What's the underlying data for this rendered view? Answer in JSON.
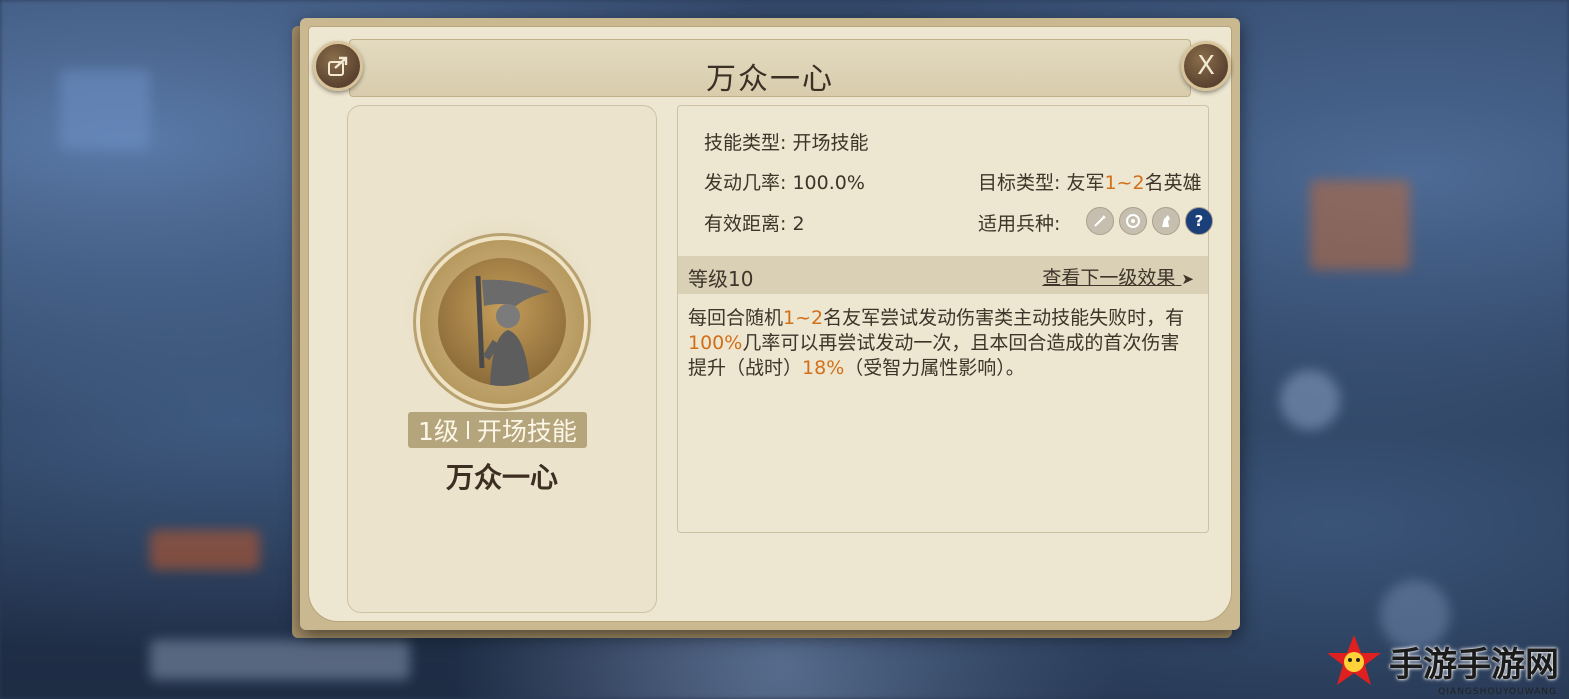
{
  "dialog": {
    "title": "万众一心",
    "share_icon": "share-icon",
    "close_label": "X"
  },
  "skill_card": {
    "level": "1级",
    "category": "开场技能",
    "name": "万众一心"
  },
  "details": {
    "type_label": "技能类型:",
    "type_value": "开场技能",
    "rate_label": "发动几率:",
    "rate_value": "100.0%",
    "target_label": "目标类型:",
    "target_prefix": "友军",
    "target_highlight": "1~2",
    "target_suffix": "名英雄",
    "range_label": "有效距离:",
    "range_value": "2",
    "units_label": "适用兵种:",
    "units": [
      "sword-icon",
      "bow-icon",
      "horse-icon",
      "question-icon"
    ],
    "question_mark": "?"
  },
  "level_section": {
    "level_text": "等级10",
    "next_level_link": "查看下一级效果",
    "arrow": "➤"
  },
  "description": {
    "p1": "每回合随机",
    "h1": "1~2",
    "p2": "名友军尝试发动伤害类主动技能失败时，有",
    "h2": "100%",
    "p3": "几率可以再尝试发动一次，且本回合造成的首次伤害提升（战时）",
    "h3": "18%",
    "p4": "（受智力属性影响）。"
  },
  "watermark": {
    "text": "手游手游网",
    "sub": "QIANGSHOUYOUWANG"
  },
  "colors": {
    "highlight": "#d2701a",
    "panel": "#ede6d0",
    "frame": "#c9b890"
  }
}
